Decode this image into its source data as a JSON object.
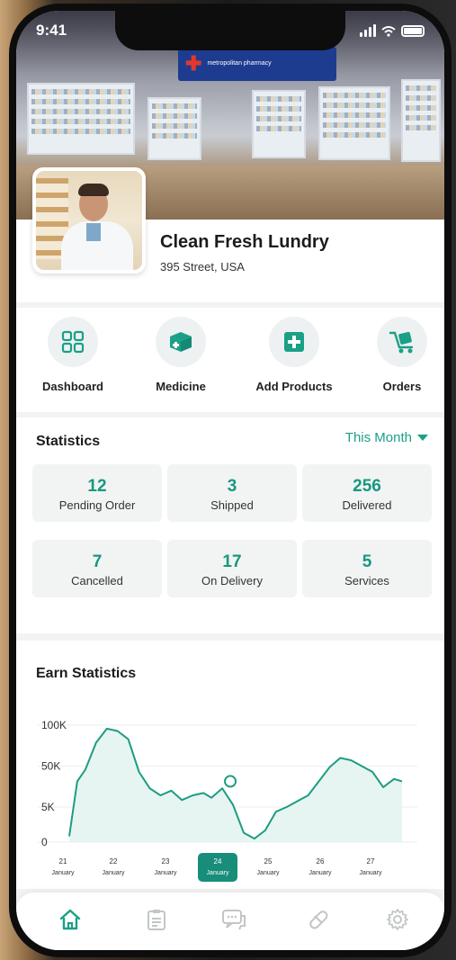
{
  "status_bar": {
    "time": "9:41"
  },
  "banner": {
    "store_sign": "metropolitan pharmacy"
  },
  "profile": {
    "name": "Clean Fresh Lundry",
    "address": "395 Street, USA"
  },
  "quick_actions": [
    {
      "label": "Dashboard",
      "icon": "dashboard-grid-icon"
    },
    {
      "label": "Medicine",
      "icon": "medicine-box-icon"
    },
    {
      "label": "Add Products",
      "icon": "add-square-icon"
    },
    {
      "label": "Orders",
      "icon": "delivery-trolley-icon"
    }
  ],
  "statistics": {
    "title": "Statistics",
    "filter": "This Month",
    "cards": [
      {
        "value": "12",
        "label": "Pending Order"
      },
      {
        "value": "3",
        "label": "Shipped"
      },
      {
        "value": "256",
        "label": "Delivered"
      },
      {
        "value": "7",
        "label": "Cancelled"
      },
      {
        "value": "17",
        "label": "On Delivery"
      },
      {
        "value": "5",
        "label": "Services"
      }
    ]
  },
  "earn_statistics": {
    "title": "Earn Statistics"
  },
  "chart_data": {
    "type": "area",
    "title": "Earn Statistics",
    "y_tick_labels": [
      "100K",
      "50K",
      "5K",
      "0"
    ],
    "x_tick_labels": [
      {
        "day": "21",
        "month": "January"
      },
      {
        "day": "22",
        "month": "January"
      },
      {
        "day": "23",
        "month": "January"
      },
      {
        "day": "24",
        "month": "January"
      },
      {
        "day": "25",
        "month": "January"
      },
      {
        "day": "26",
        "month": "January"
      },
      {
        "day": "27",
        "month": "January"
      }
    ],
    "selected_x_index": 3,
    "y_scale": "categorical (100K, 50K, 5K, 0)",
    "grid": true,
    "series": [
      {
        "values": [
          {
            "x": 20.95,
            "y": 5
          },
          {
            "x": 21.1,
            "y": 52
          },
          {
            "x": 21.25,
            "y": 62
          },
          {
            "x": 21.45,
            "y": 85
          },
          {
            "x": 21.65,
            "y": 97
          },
          {
            "x": 21.85,
            "y": 95
          },
          {
            "x": 22.05,
            "y": 88
          },
          {
            "x": 22.25,
            "y": 60
          },
          {
            "x": 22.45,
            "y": 46
          },
          {
            "x": 22.65,
            "y": 40
          },
          {
            "x": 22.85,
            "y": 44
          },
          {
            "x": 23.05,
            "y": 36
          },
          {
            "x": 23.25,
            "y": 40
          },
          {
            "x": 23.45,
            "y": 42
          },
          {
            "x": 23.6,
            "y": 38
          },
          {
            "x": 23.8,
            "y": 46
          },
          {
            "x": 24.0,
            "y": 32
          },
          {
            "x": 24.2,
            "y": 8
          },
          {
            "x": 24.4,
            "y": 3
          },
          {
            "x": 24.6,
            "y": 10
          },
          {
            "x": 24.8,
            "y": 26
          },
          {
            "x": 25.0,
            "y": 30
          },
          {
            "x": 25.2,
            "y": 35
          },
          {
            "x": 25.4,
            "y": 40
          },
          {
            "x": 25.6,
            "y": 52
          },
          {
            "x": 25.8,
            "y": 64
          },
          {
            "x": 26.0,
            "y": 72
          },
          {
            "x": 26.2,
            "y": 70
          },
          {
            "x": 26.4,
            "y": 65
          },
          {
            "x": 26.6,
            "y": 60
          },
          {
            "x": 26.8,
            "y": 47
          },
          {
            "x": 27.0,
            "y": 54
          },
          {
            "x": 27.15,
            "y": 52
          }
        ]
      }
    ],
    "highlight_point": {
      "x": 23.95,
      "y": 52
    },
    "colors": {
      "line": "#1d9c83",
      "fill": "#e6f5f2",
      "selected_badge": "#178d7a"
    }
  },
  "bottom_nav": [
    {
      "name": "nav-home",
      "icon": "home-icon",
      "active": true
    },
    {
      "name": "nav-orders",
      "icon": "clipboard-list-icon",
      "active": false
    },
    {
      "name": "nav-messages",
      "icon": "chat-bubble-icon",
      "active": false
    },
    {
      "name": "nav-medicine",
      "icon": "pill-icon",
      "active": false
    },
    {
      "name": "nav-settings",
      "icon": "gear-icon",
      "active": false
    }
  ],
  "colors": {
    "accent": "#1aa087",
    "accent_dark": "#179880",
    "card_bg": "#f2f3f3",
    "inactive_icon": "#c2c6c6"
  }
}
